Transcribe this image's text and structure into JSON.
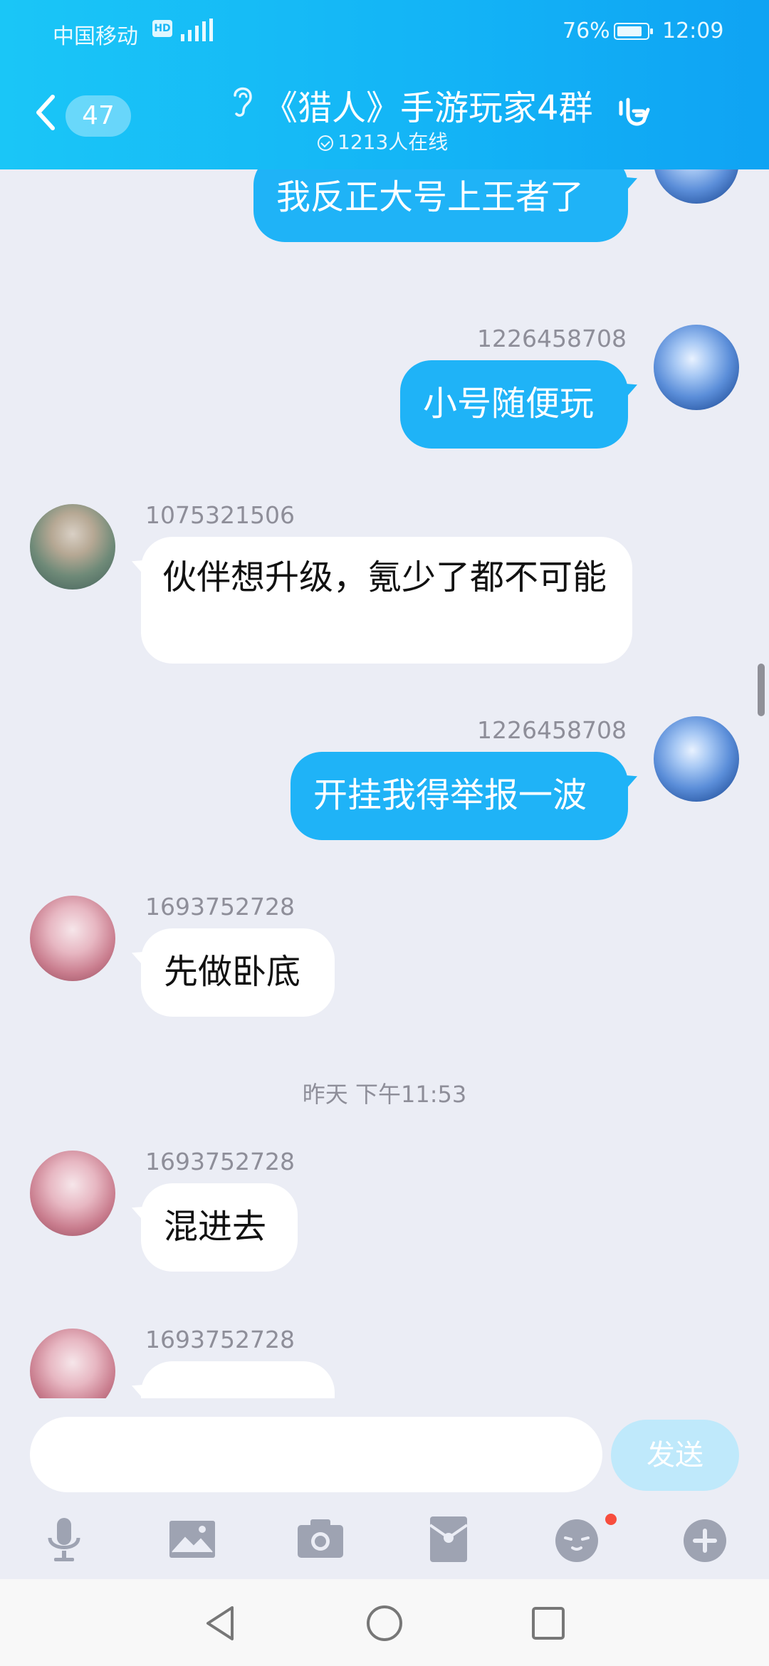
{
  "status": {
    "carrier": "中国移动",
    "badge": "HD",
    "battery": "76%",
    "time": "12:09"
  },
  "header": {
    "unread_count": "47",
    "title": "《猎人》手游玩家4群",
    "online": "1213人在线"
  },
  "messages": [
    {
      "sender": "1226458708",
      "text": "我反正大号上王者了",
      "side": "out"
    },
    {
      "sender": "1226458708",
      "text": "小号随便玩",
      "side": "out"
    },
    {
      "sender": "1075321506",
      "text": "伙伴想升级，氪少了都不可能",
      "side": "in"
    },
    {
      "sender": "1226458708",
      "text": "开挂我得举报一波",
      "side": "out"
    },
    {
      "sender": "1693752728",
      "text": "先做卧底",
      "side": "in"
    },
    {
      "separator": "昨天 下午11:53"
    },
    {
      "sender": "1693752728",
      "text": "混进去",
      "side": "in"
    },
    {
      "sender": "1693752728",
      "text": "",
      "side": "in"
    }
  ],
  "input": {
    "value": "",
    "send_label": "发送"
  },
  "toolbar": [
    "mic-icon",
    "image-icon",
    "camera-icon",
    "red-packet-icon",
    "emoji-icon",
    "plus-icon"
  ],
  "colors": {
    "header": "#13b3f6",
    "bubble_out": "#1fb3f7",
    "bubble_in": "#ffffff",
    "background": "#ebedf5"
  }
}
